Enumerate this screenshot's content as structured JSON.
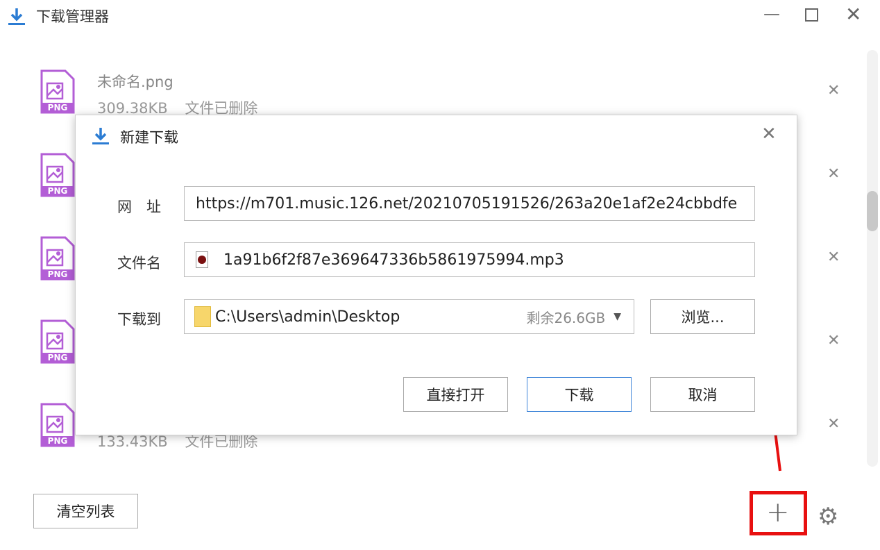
{
  "window": {
    "title": "下载管理器"
  },
  "downloads": [
    {
      "name": "未命名.png",
      "size": "309.38KB",
      "status": "文件已删除",
      "type": "PNG"
    },
    {
      "type": "PNG"
    },
    {
      "type": "PNG"
    },
    {
      "type": "PNG"
    },
    {
      "size": "133.43KB",
      "status": "文件已删除",
      "type": "PNG"
    }
  ],
  "footer": {
    "clear_label": "清空列表"
  },
  "dialog": {
    "title": "新建下载",
    "url_label": "网　址",
    "url_value": "https://m701.music.126.net/20210705191526/263a20e1af2e24cbbdfe",
    "filename_label": "文件名",
    "filename_value": "1a91b6f2f87e369647336b5861975994.mp3",
    "saveto_label": "下载到",
    "saveto_value": "C:\\Users\\admin\\Desktop",
    "free_space": "剩余26.6GB",
    "browse_label": "浏览...",
    "open_label": "直接打开",
    "download_label": "下载",
    "cancel_label": "取消"
  },
  "colors": {
    "accent": "#2b7cd3",
    "annotation": "#e81010",
    "png_icon": "#b35ed6"
  }
}
